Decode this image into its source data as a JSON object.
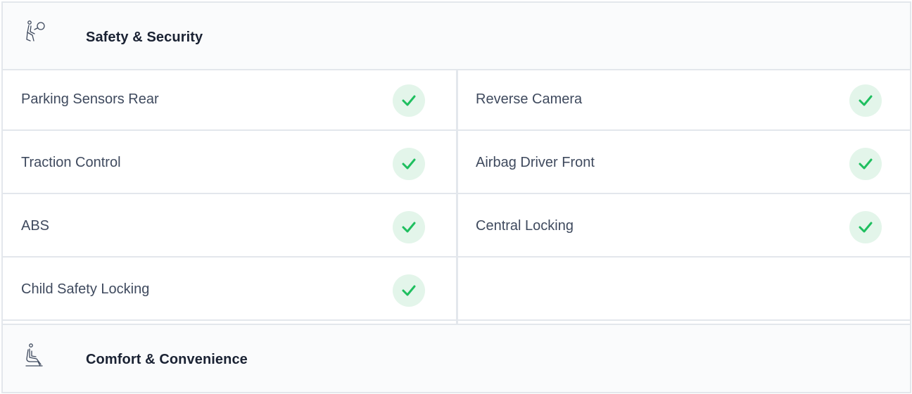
{
  "sections": [
    {
      "title": "Safety & Security",
      "icon": "airbag-icon"
    },
    {
      "title": "Comfort & Convenience",
      "icon": "car-seat-icon"
    }
  ],
  "features": [
    {
      "label": "Parking Sensors Rear",
      "available": true
    },
    {
      "label": "Reverse Camera",
      "available": true
    },
    {
      "label": "Traction Control",
      "available": true
    },
    {
      "label": "Airbag Driver Front",
      "available": true
    },
    {
      "label": "ABS",
      "available": true
    },
    {
      "label": "Central Locking",
      "available": true
    },
    {
      "label": "Child Safety Locking",
      "available": true
    }
  ],
  "colors": {
    "check_bg": "#e3f5ea",
    "check_mark": "#1fbf5f",
    "border": "#e3e7ec",
    "label_text": "#3f4a5e",
    "title_text": "#1a2233"
  }
}
